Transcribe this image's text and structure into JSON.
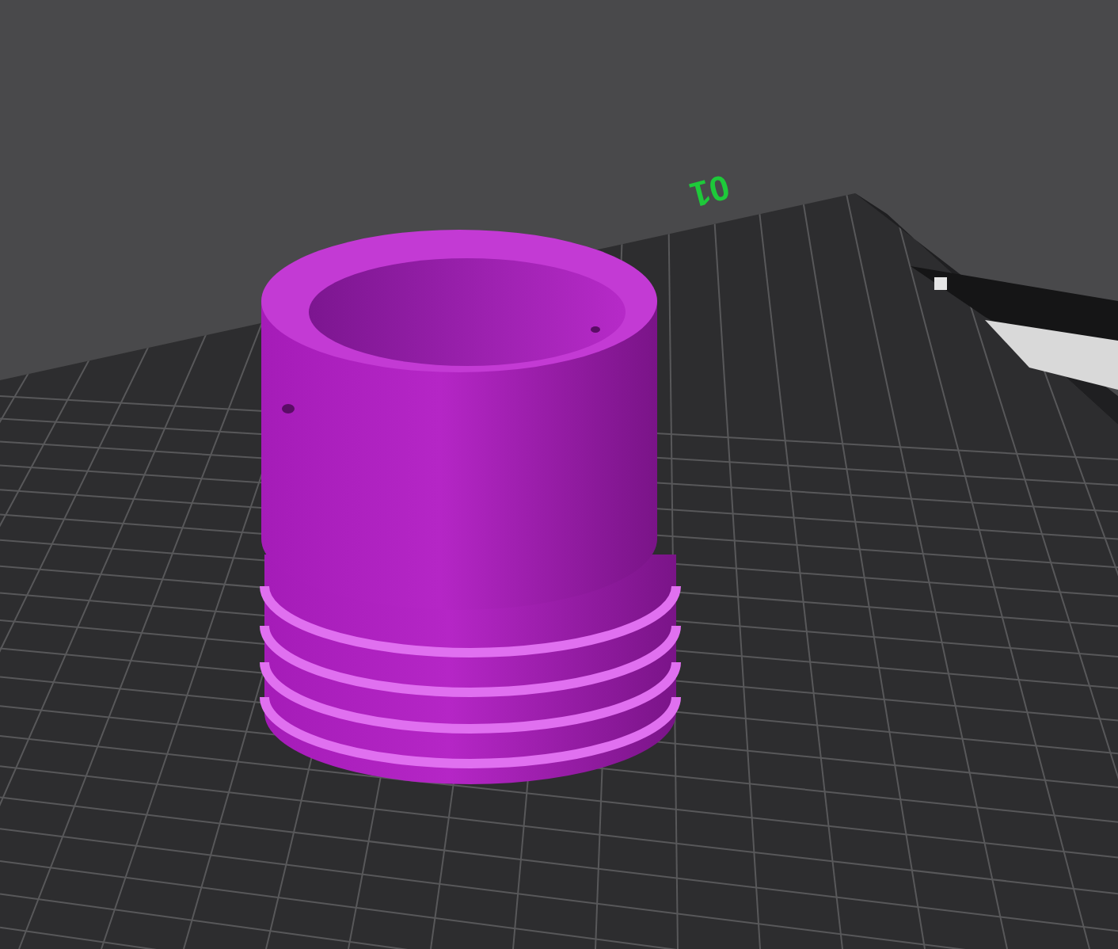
{
  "viewport": {
    "plate_number": "01"
  }
}
